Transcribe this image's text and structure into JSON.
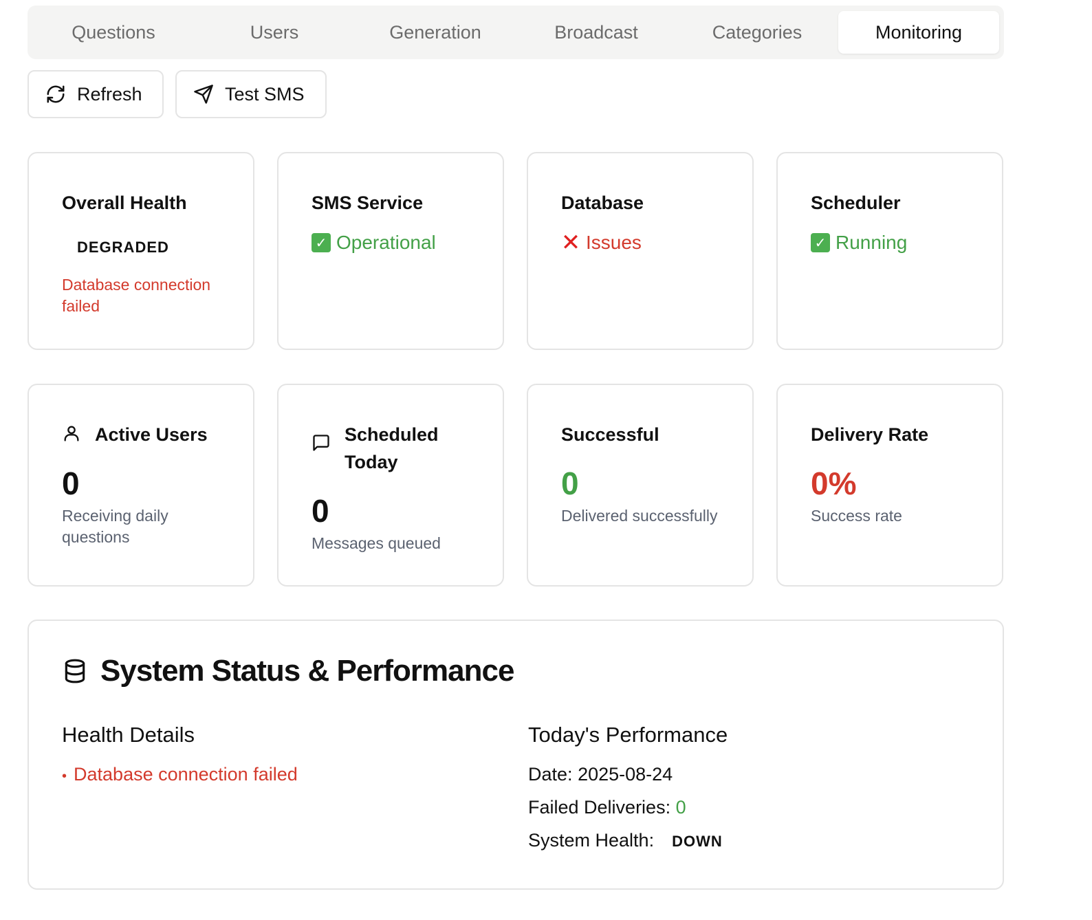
{
  "tabs": [
    {
      "label": "Questions"
    },
    {
      "label": "Users"
    },
    {
      "label": "Generation"
    },
    {
      "label": "Broadcast"
    },
    {
      "label": "Categories"
    },
    {
      "label": "Monitoring"
    }
  ],
  "active_tab": "Monitoring",
  "toolbar": {
    "refresh_label": "Refresh",
    "test_sms_label": "Test SMS"
  },
  "status_cards": {
    "overall": {
      "title": "Overall Health",
      "badge": "DEGRADED",
      "error": "Database connection failed"
    },
    "sms": {
      "title": "SMS Service",
      "icon": "check-icon",
      "status": "Operational",
      "color": "#43a047"
    },
    "database": {
      "title": "Database",
      "icon": "cross-icon",
      "status": "Issues",
      "color": "#d33a2c"
    },
    "scheduler": {
      "title": "Scheduler",
      "icon": "check-icon",
      "status": "Running",
      "color": "#43a047"
    }
  },
  "stats": {
    "active_users": {
      "title": "Active Users",
      "icon": "user-icon",
      "value": "0",
      "caption": "Receiving daily questions"
    },
    "scheduled": {
      "title": "Scheduled Today",
      "icon": "message-icon",
      "value": "0",
      "caption": "Messages queued"
    },
    "successful": {
      "title": "Successful",
      "value": "0",
      "caption": "Delivered successfully"
    },
    "delivery_rate": {
      "title": "Delivery Rate",
      "value": "0%",
      "caption": "Success rate"
    }
  },
  "panel": {
    "title": "System Status & Performance",
    "icon": "database-icon",
    "health": {
      "heading": "Health Details",
      "bullet": "•",
      "items": [
        "Database connection failed"
      ]
    },
    "performance": {
      "heading": "Today's Performance",
      "date_label": "Date:",
      "date": "2025-08-24",
      "failed_label": "Failed Deliveries:",
      "failed": "0",
      "health_label": "System Health:",
      "health": "DOWN"
    }
  },
  "colors": {
    "accent_green": "#43a047",
    "error_red": "#d33a2c",
    "border": "#e4e4e4"
  }
}
